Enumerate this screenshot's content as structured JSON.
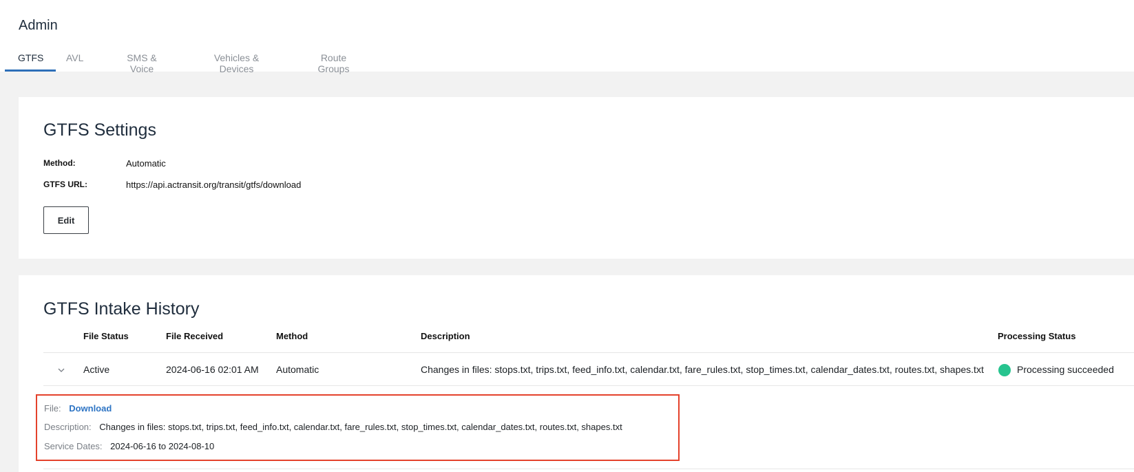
{
  "header": {
    "title": "Admin",
    "tabs": [
      {
        "label": "GTFS",
        "active": true
      },
      {
        "label": "AVL",
        "active": false
      },
      {
        "label": "SMS & Voice",
        "active": false
      },
      {
        "label": "Vehicles & Devices",
        "active": false
      },
      {
        "label": "Route Groups",
        "active": false
      }
    ]
  },
  "settings": {
    "title": "GTFS Settings",
    "method_label": "Method:",
    "method_value": "Automatic",
    "url_label": "GTFS URL:",
    "url_value": "https://api.actransit.org/transit/gtfs/download",
    "edit_label": "Edit"
  },
  "history": {
    "title": "GTFS Intake History",
    "columns": [
      "File Status",
      "File Received",
      "Method",
      "Description",
      "Processing Status"
    ],
    "rows": [
      {
        "file_status": "Active",
        "file_received": "2024-06-16 02:01 AM",
        "method": "Automatic",
        "description": "Changes in files: stops.txt, trips.txt, feed_info.txt, calendar.txt, fare_rules.txt, stop_times.txt, calendar_dates.txt, routes.txt, shapes.txt",
        "processing_status": "Processing succeeded",
        "expanded": true
      }
    ],
    "detail": {
      "file_label": "File:",
      "file_link": "Download",
      "description_label": "Description:",
      "description_value": "Changes in files: stops.txt, trips.txt, feed_info.txt, calendar.txt, fare_rules.txt, stop_times.txt, calendar_dates.txt, routes.txt, shapes.txt",
      "service_dates_label": "Service Dates:",
      "service_dates_value": "2024-06-16 to 2024-08-10"
    }
  },
  "colors": {
    "accent": "#2d6fb8",
    "success": "#27c48f",
    "highlight_border": "#e4412b",
    "link": "#2d74c4"
  }
}
